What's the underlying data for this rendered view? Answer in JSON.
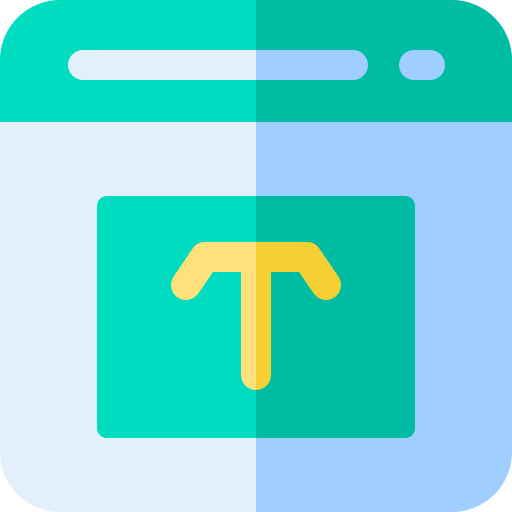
{
  "icon": {
    "name": "browser-text-icon",
    "colors": {
      "title_bar_left": "#00DCC0",
      "title_bar_right": "#00BCA2",
      "window_body_left": "#E3F0FC",
      "window_body_right": "#A0CFFF",
      "address_bar_left": "#E3F0FC",
      "address_bar_right": "#A0CFFF",
      "text_box_left": "#00DCC0",
      "text_box_right": "#00BCA2",
      "text_glyph_left": "#FFE07A",
      "text_glyph_right": "#F4D033"
    }
  }
}
